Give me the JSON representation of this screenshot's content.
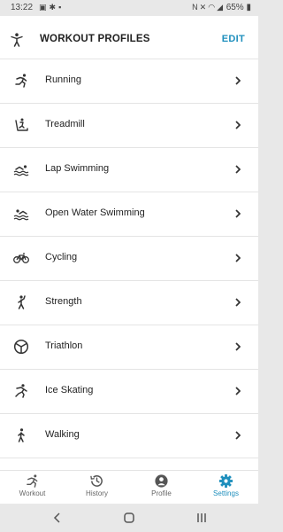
{
  "status_bar": {
    "time": "13:22",
    "battery": "65%",
    "left_icons": [
      "image-icon",
      "notification-icon",
      "lock-icon"
    ],
    "right_icons": [
      "nfc-icon",
      "mute-icon",
      "wifi-icon",
      "signal-icon",
      "battery-icon"
    ]
  },
  "header": {
    "title": "Workout Profiles",
    "icon": "person-stand-icon",
    "edit_label": "EDIT",
    "accent_color": "#1e8fbd"
  },
  "profiles": [
    {
      "label": "Running",
      "icon": "running-icon"
    },
    {
      "label": "Treadmill",
      "icon": "treadmill-icon"
    },
    {
      "label": "Lap Swimming",
      "icon": "lap-swimming-icon"
    },
    {
      "label": "Open Water Swimming",
      "icon": "open-water-swimming-icon"
    },
    {
      "label": "Cycling",
      "icon": "cycling-icon"
    },
    {
      "label": "Strength",
      "icon": "strength-icon"
    },
    {
      "label": "Triathlon",
      "icon": "triathlon-icon"
    },
    {
      "label": "Ice Skating",
      "icon": "ice-skating-icon"
    },
    {
      "label": "Walking",
      "icon": "walking-icon"
    }
  ],
  "tabs": [
    {
      "label": "Workout",
      "icon": "workout-icon",
      "active": false
    },
    {
      "label": "History",
      "icon": "history-icon",
      "active": false
    },
    {
      "label": "Profile",
      "icon": "profile-icon",
      "active": false
    },
    {
      "label": "Settings",
      "icon": "settings-gear-icon",
      "active": true
    }
  ],
  "nav_bar": {
    "buttons": [
      "back-icon",
      "home-icon",
      "recents-icon"
    ]
  }
}
